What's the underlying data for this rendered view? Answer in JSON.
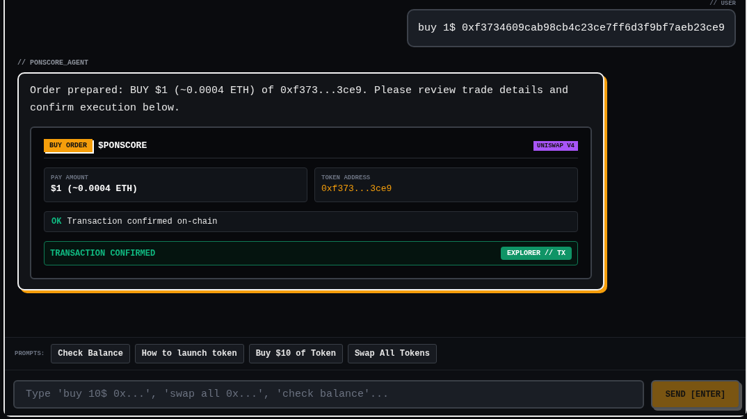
{
  "user_message": {
    "label": "// USER",
    "text": "buy 1$ 0xf3734609cab98cb4c23ce7ff6d3f9bf7aeb23ce9"
  },
  "agent_message": {
    "label": "// PONSCORE_AGENT",
    "text": "Order prepared: BUY $1 (~0.0004 ETH) of 0xf373...3ce9. Please review trade details and confirm execution below.",
    "order": {
      "side": "BUY ORDER",
      "token": "$PONSCORE",
      "venue": "UNISWAP V4",
      "fields": [
        {
          "label": "PAY AMOUNT",
          "value": "$1 (~0.0004 ETH)",
          "kind": "amount"
        },
        {
          "label": "TOKEN ADDRESS",
          "value": "0xf373...3ce9",
          "kind": "address"
        }
      ],
      "status": {
        "code": "OK",
        "text": "Transaction confirmed on-chain"
      },
      "result": {
        "text": "TRANSACTION CONFIRMED",
        "link": "EXPLORER // TX"
      }
    }
  },
  "prompts": {
    "label": "PROMPTS:",
    "items": [
      "Check Balance",
      "How to launch token",
      "Buy $10 of Token",
      "Swap All Tokens"
    ]
  },
  "composer": {
    "placeholder": "Type 'buy 10$ 0x...', 'swap all 0x...', 'check balance'...",
    "send": "SEND [ENTER]"
  }
}
